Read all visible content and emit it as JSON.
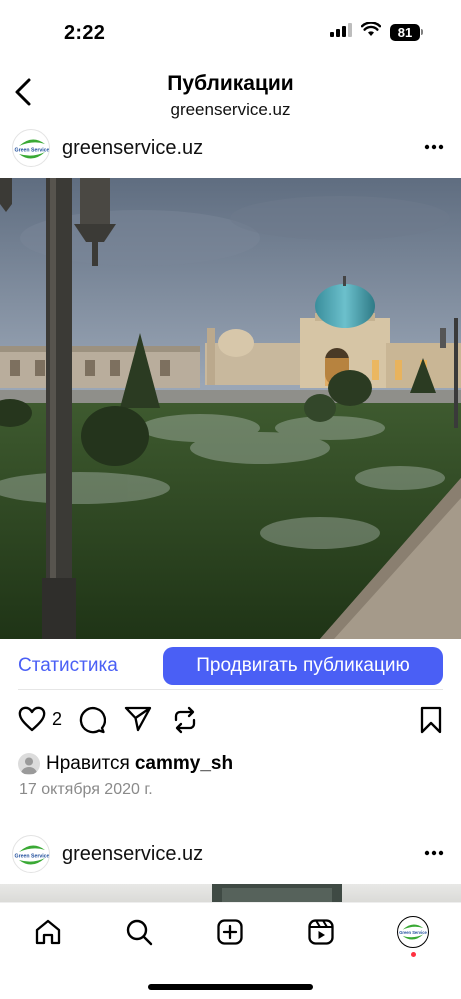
{
  "status_bar": {
    "time": "2:22",
    "battery": "81",
    "icons": [
      "signal-icon",
      "wifi-icon",
      "battery-icon"
    ]
  },
  "header": {
    "title": "Публикации",
    "subtitle": "greenservice.uz",
    "back_icon": "chevron-left-icon"
  },
  "post": {
    "username": "greenservice.uz",
    "avatar_logo_text": "Green Service",
    "more_icon": "more-horizontal-icon",
    "stats_label": "Статистика",
    "promote_label": "Продвигать публикацию",
    "like_count": "2",
    "likes_prefix": "Нравится",
    "likes_user": "cammy_sh",
    "date": "17 октября 2020 г.",
    "action_icons": [
      "heart-icon",
      "comment-icon",
      "share-icon",
      "repost-icon",
      "bookmark-icon"
    ]
  },
  "next_post": {
    "username": "greenservice.uz",
    "more_icon": "more-horizontal-icon"
  },
  "bottom_nav": {
    "items": [
      "home-icon",
      "search-icon",
      "create-icon",
      "reels-icon",
      "profile-avatar"
    ]
  },
  "colors": {
    "accent": "#4a5ff5",
    "notification": "#ff3040",
    "date_text": "#8a8a8a"
  }
}
